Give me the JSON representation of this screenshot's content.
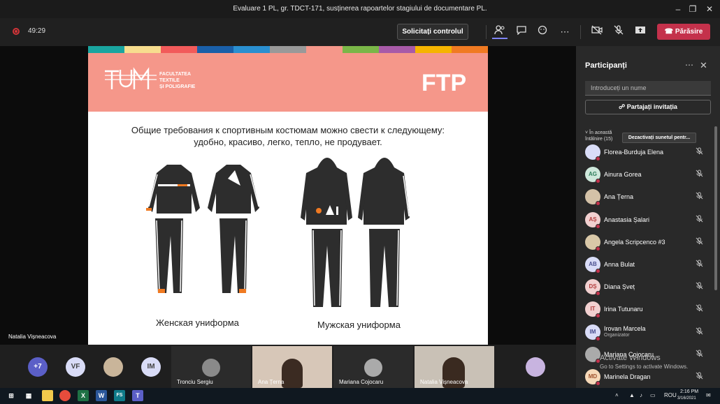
{
  "window": {
    "title": "Evaluare 1 PL, gr. TDCT-171, susținerea rapoartelor stagiului de documentare PL.",
    "minimize_icon": "minimize-icon",
    "restore_icon": "restore-icon",
    "close_icon": "close-icon"
  },
  "meeting": {
    "timer": "49:29",
    "request_control_label": "Solicitați controlul",
    "leave_label": "Părăsire",
    "leave_color": "#c4314b"
  },
  "slide": {
    "faculty_line1": "FACULTATEA",
    "faculty_line2": "TEXTILE",
    "faculty_line3": "ȘI POLIGRAFIE",
    "logo_letters": "UTM",
    "right_logo": "FTP",
    "text_line1": "Общие требования к спортивным костюмам можно свести к следующему:",
    "text_line2": "удобно, красиво, легко, тепло, не продувает.",
    "female_label": "Женская униформа",
    "male_label": "Мужская униформа",
    "header_color": "#f5978a",
    "color_strip": [
      "#1aa5a0",
      "#f7dd8e",
      "#f25a5a",
      "#1a5fa8",
      "#2a8fd0",
      "#999999",
      "#f5978a",
      "#7ab648",
      "#a85aa8",
      "#f5b400",
      "#f07a22"
    ]
  },
  "presenter_name": "Natalia Vișneacova",
  "bottom_row": {
    "overflow_count": "+7",
    "initials_1": "VF",
    "initials_2": "IM",
    "tiles": [
      {
        "name": "Tronciu Sergiu"
      },
      {
        "name": "Ana Țerna"
      },
      {
        "name": "Mariana Cojocaru"
      },
      {
        "name": "Natalia Vișneacova"
      }
    ]
  },
  "panel": {
    "title": "Participanți",
    "search_placeholder": "Introduceți un nume",
    "share_label": "Partajați invitația",
    "section_title": "În această întâlnire (15)",
    "mute_all_label": "Dezactivați sunetul pentr...",
    "participants": [
      {
        "name": "Florea-Burduja Elena",
        "initials": "",
        "role": ""
      },
      {
        "name": "Ainura Gorea",
        "initials": "AG",
        "role": ""
      },
      {
        "name": "Ana Țerna",
        "initials": "",
        "role": ""
      },
      {
        "name": "Anastasia Șalari",
        "initials": "AȘ",
        "role": ""
      },
      {
        "name": "Angela Scripcenco #3",
        "initials": "",
        "role": ""
      },
      {
        "name": "Anna Bulat",
        "initials": "AB",
        "role": ""
      },
      {
        "name": "Diana Șveț",
        "initials": "DȘ",
        "role": ""
      },
      {
        "name": "Irina Tutunaru",
        "initials": "IT",
        "role": ""
      },
      {
        "name": "Irovan Marcela",
        "initials": "IM",
        "role": "Organizator"
      },
      {
        "name": "Mariana Cojocaru",
        "initials": "",
        "role": ""
      },
      {
        "name": "Marinela Dragan",
        "initials": "MD",
        "role": ""
      }
    ],
    "watermark_title": "Activate Windows",
    "watermark_sub": "Go to Settings to activate Windows."
  },
  "taskbar": {
    "lang": "ROU",
    "time": "2:16 PM",
    "date": "3/16/2021"
  }
}
